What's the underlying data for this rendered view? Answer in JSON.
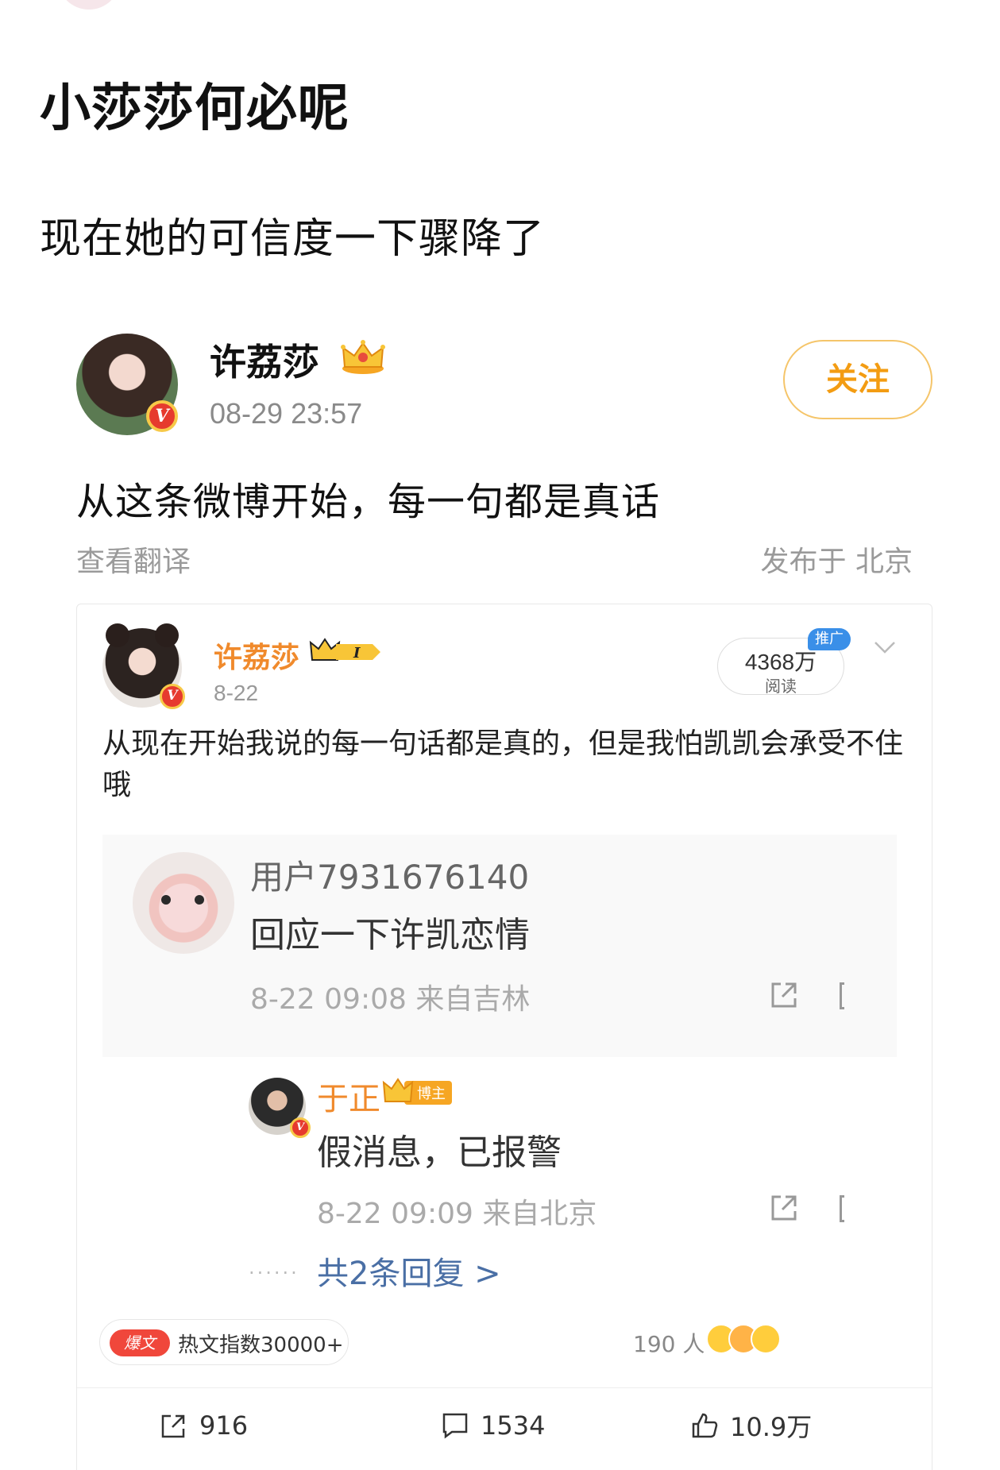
{
  "post": {
    "title": "小莎莎何必呢",
    "subtitle": "现在她的可信度一下骤降了"
  },
  "author": {
    "name": "许荔莎",
    "time": "08-29 23:57",
    "follow_label": "关注",
    "verified_mark": "V"
  },
  "body": {
    "text": "从这条微博开始，每一句都是真话",
    "translate_label": "查看翻译",
    "location": "发布于 北京"
  },
  "embed": {
    "author_name": "许荔莎",
    "level_badge_text": "I",
    "date": "8-22",
    "read_count": "4368万",
    "read_label": "阅读",
    "promo_label": "推广",
    "body": "从现在开始我说的每一句话都是真的，但是我怕凯凯会承受不住哦",
    "comment": {
      "user": "用户7931676140",
      "text": "回应一下许凯恋情",
      "meta": "8-22 09:08 来自吉林"
    },
    "reply": {
      "user": "于正",
      "badge": "博主",
      "text": "假消息，已报警",
      "meta": "8-22 09:09 来自北京",
      "more_label": "共2条回复 >"
    },
    "hot": {
      "tag": "爆文",
      "text": "热文指数30000+"
    },
    "reactions": {
      "count": "190 人"
    },
    "actions": {
      "repost_count": "916",
      "comment_count": "1534",
      "like_count": "10.9万"
    }
  },
  "colors": {
    "accent_orange": "#f08a2c",
    "follow_orange": "#f39c12",
    "link_blue": "#4a6fa5",
    "verified_red": "#e63a2e",
    "hot_red": "#f0473b"
  },
  "icons": [
    "crown-icon",
    "verified-icon",
    "chevron-down-icon",
    "share-icon",
    "repost-icon",
    "comment-icon",
    "like-icon",
    "emoji-icon"
  ]
}
